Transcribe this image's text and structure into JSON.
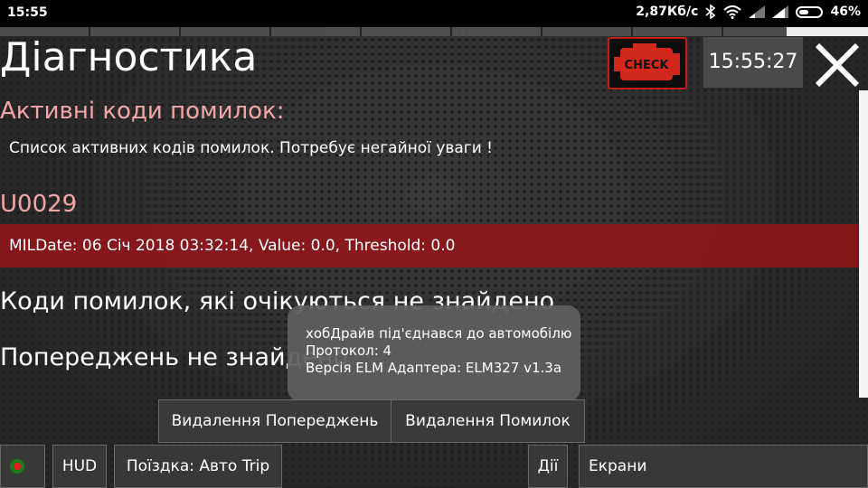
{
  "status_bar": {
    "time": "15:55",
    "network_speed": "2,87Кб/с",
    "battery": "46%",
    "icons": [
      "bluetooth-icon",
      "wifi-icon",
      "signal-icon",
      "signal-icon",
      "battery-icon"
    ]
  },
  "header": {
    "title": "Діагностика",
    "check_label": "CHECK",
    "clock": "15:55:27",
    "close_icon": "close-icon"
  },
  "active": {
    "title": "Активні коди помилок:",
    "description": "Список активних кодів помилок. Потребує негайної уваги !",
    "code": "U0029",
    "detail": "MILDate: 06 Січ 2018 03:32:14, Value: 0.0, Threshold: 0.0"
  },
  "pending": {
    "text": "Коди помилок, які очікуються не знайдено"
  },
  "warnings": {
    "text": "Попереджень не знайдено"
  },
  "toast": {
    "line1": "хобДрайв під'єднався до автомобілю",
    "line2": "Протокол: 4",
    "line3": "Версія ELM Адаптера: ELM327 v1.3a"
  },
  "actions": {
    "delete_warnings": "Видалення Попереджень",
    "delete_errors": "Видалення Помилок"
  },
  "bottom_bar": {
    "hud": "HUD",
    "trip": "Поїздка: Авто Trip",
    "actions": "Дії",
    "screens": "Екрани"
  },
  "colors": {
    "accent_pink": "#f3a6a8",
    "error_band": "#96141a",
    "check_red": "#c21e14"
  }
}
